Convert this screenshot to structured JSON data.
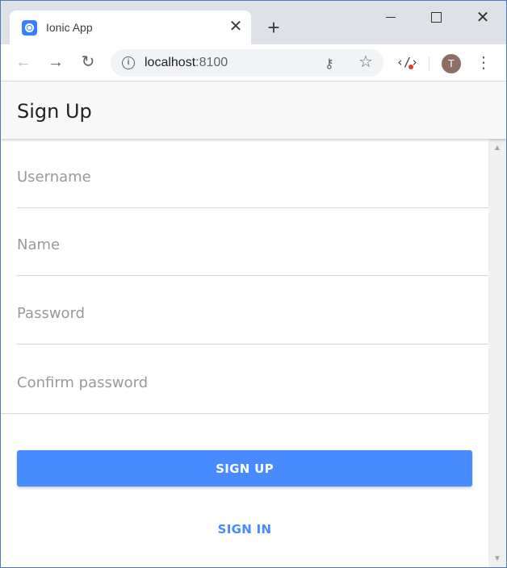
{
  "browser": {
    "tab": {
      "title": "Ionic App",
      "close_glyph": "✕"
    },
    "new_tab_glyph": "+",
    "window_controls": {
      "close_glyph": "✕"
    },
    "nav": {
      "back_glyph": "←",
      "forward_glyph": "→",
      "reload_glyph": "↻"
    },
    "address": {
      "host": "localhost",
      "port": ":8100",
      "info_glyph": "i"
    },
    "icons": {
      "key": "⚷",
      "star": "☆",
      "ext": "‹/›",
      "menu": "⋮"
    },
    "profile_initial": "T"
  },
  "app": {
    "title": "Sign Up",
    "fields": {
      "username": {
        "placeholder": "Username",
        "value": ""
      },
      "name": {
        "placeholder": "Name",
        "value": ""
      },
      "password": {
        "placeholder": "Password",
        "value": ""
      },
      "confirm_password": {
        "placeholder": "Confirm password",
        "value": ""
      }
    },
    "buttons": {
      "signup": "SIGN UP",
      "signin": "SIGN IN"
    }
  },
  "scrollbar": {
    "up_glyph": "▲",
    "down_glyph": "▼"
  },
  "colors": {
    "primary": "#488aff",
    "favicon": "#3880ff",
    "avatar": "#8d6e63"
  }
}
